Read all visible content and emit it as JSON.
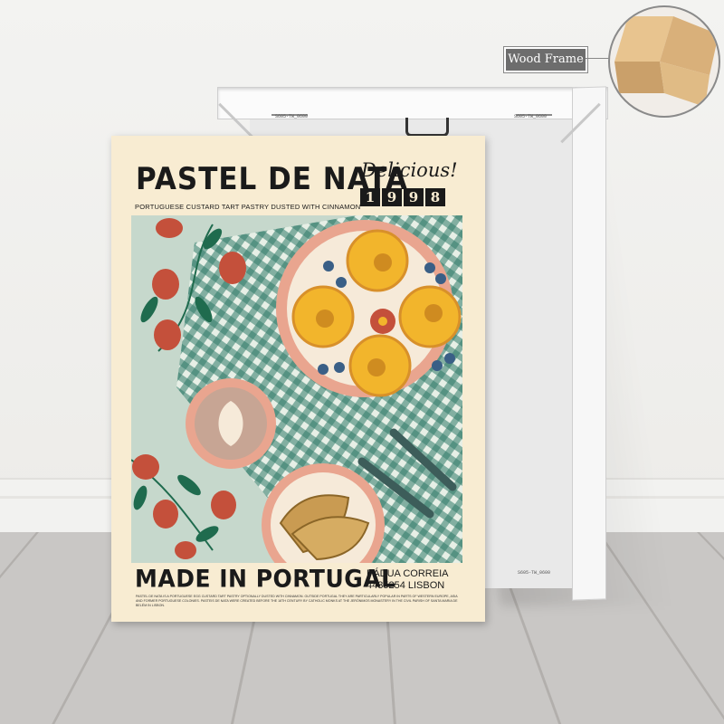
{
  "poster": {
    "title": "PASTEL DE NATA",
    "script": "Delicious!",
    "year_digits": [
      "1",
      "9",
      "9",
      "8"
    ],
    "subtitle": "PORTUGUESE CUSTARD TART PASTRY DUSTED WITH CINNAMON",
    "made_in": "MADE IN PORTUGAL",
    "address_line1": "PÁDUA CORREIA",
    "address_line2": "4435254 LISBON",
    "fine_print": "PASTEL DE NATA IS A PORTUGUESE EGG CUSTARD TART PASTRY OPTIONALLY DUSTED WITH CINNAMON. OUTSIDE PORTUGAL THEY ARE PARTICULARLY POPULAR IN PARTS OF WESTERN EUROPE, ASIA AND FORMER PORTUGUESE COLONIES. PASTEIS DE NATA WERE CREATED BEFORE THE 18TH CENTURY BY CATHOLIC MONKS AT THE JERÓNIMOS MONASTERY IN THE CIVIL PARISH OF SANTA MARIA DE BELÉM IN LISBON."
  },
  "callout": {
    "label": "Wood Frame"
  },
  "canvas_back": {
    "label": "S605-TW_0600"
  },
  "colors": {
    "poster_bg": "#f8ecd2",
    "art_bg": "#c6d8cc",
    "gingham": "#2f7a68",
    "plate": "#f1c5ad",
    "tart": "#f2b52c",
    "berry": "#c4503b",
    "leaf": "#1f6b4e",
    "blueberry": "#3a5f86"
  }
}
